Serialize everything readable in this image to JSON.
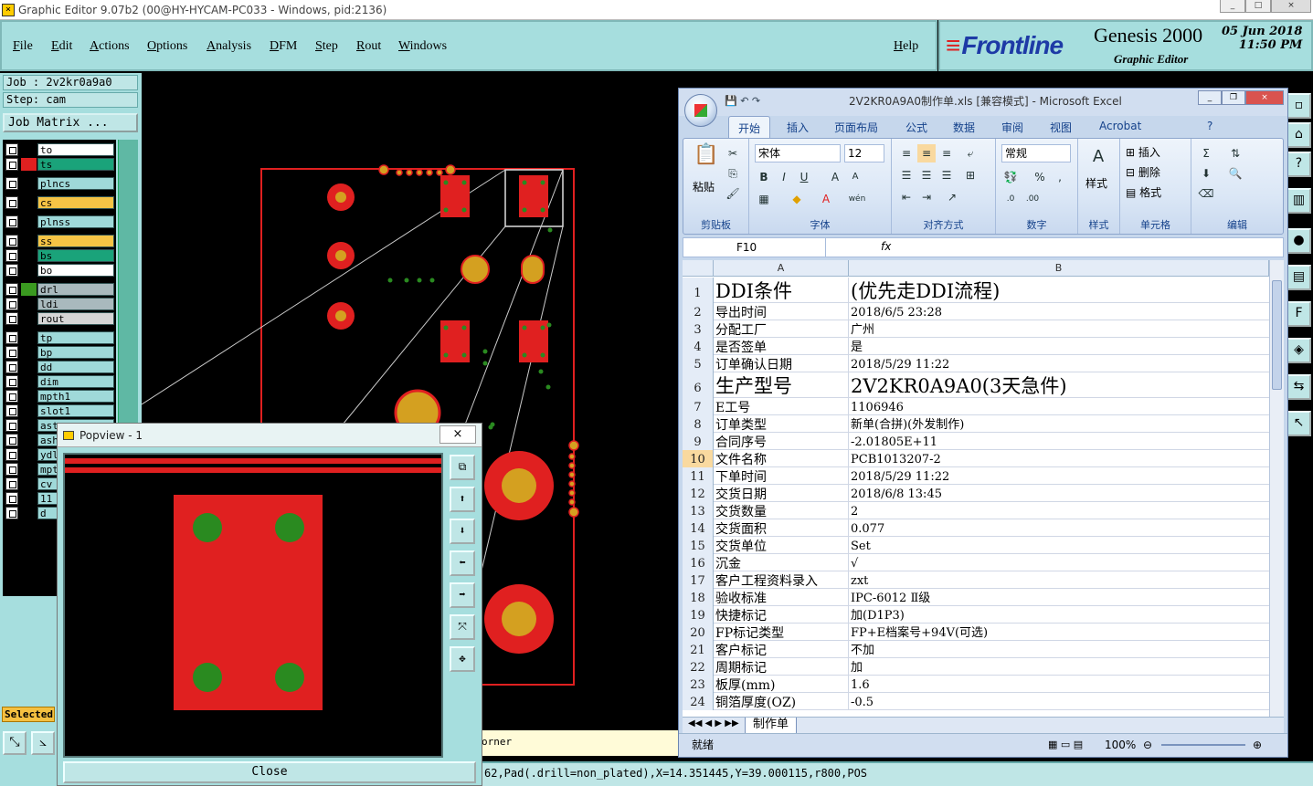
{
  "window": {
    "title": "Graphic Editor 9.07b2 (00@HY-HYCAM-PC033 - Windows, pid:2136)"
  },
  "menu": {
    "items": [
      "File",
      "Edit",
      "Actions",
      "Options",
      "Analysis",
      "DFM",
      "Step",
      "Rout",
      "Windows"
    ],
    "help": "Help"
  },
  "brand": {
    "logo": "Frontline",
    "product": "Genesis 2000",
    "subtitle": "Graphic Editor",
    "date": "05 Jun 2018",
    "time": "11:50 PM"
  },
  "job": {
    "job_label": "Job : 2v2kr0a9a0",
    "step_label": "Step: cam",
    "matrix_button": "Job Matrix ..."
  },
  "layers": [
    {
      "name": "to",
      "bg": "#ffffff",
      "swatch": "#000000"
    },
    {
      "name": "ts",
      "bg": "#1aa37a",
      "swatch": "#e02020",
      "active": true
    },
    {
      "name": "plncs",
      "bg": "#9fd9d9",
      "swatch": "#000000"
    },
    {
      "name": "cs",
      "bg": "#f6c445",
      "swatch": "#000000"
    },
    {
      "name": "plnss",
      "bg": "#9fd9d9",
      "swatch": "#000000"
    },
    {
      "name": "ss",
      "bg": "#f6c445",
      "swatch": "#000000"
    },
    {
      "name": "bs",
      "bg": "#1aa37a",
      "swatch": "#000000"
    },
    {
      "name": "bo",
      "bg": "#ffffff",
      "swatch": "#000000"
    },
    {
      "name": "drl",
      "bg": "#a9b9bd",
      "swatch": "#3a9a20"
    },
    {
      "name": "ldi",
      "bg": "#a9b9bd",
      "swatch": "#000000"
    },
    {
      "name": "rout",
      "bg": "#d6d6d6",
      "swatch": "#000000"
    },
    {
      "name": "tp",
      "bg": "#9fd9d9",
      "swatch": "#000000"
    },
    {
      "name": "bp",
      "bg": "#9fd9d9",
      "swatch": "#000000"
    },
    {
      "name": "dd",
      "bg": "#9fd9d9",
      "swatch": "#000000"
    },
    {
      "name": "dim",
      "bg": "#9fd9d9",
      "swatch": "#000000"
    },
    {
      "name": "mpth1",
      "bg": "#9fd9d9",
      "swatch": "#000000"
    },
    {
      "name": "slot1",
      "bg": "#9fd9d9",
      "swatch": "#000000"
    },
    {
      "name": "ast",
      "bg": "#9fd9d9",
      "swatch": "#000000"
    },
    {
      "name": "ash",
      "bg": "#9fd9d9",
      "swatch": "#000000"
    },
    {
      "name": "ydl",
      "bg": "#9fd9d9",
      "swatch": "#000000"
    },
    {
      "name": "mpt",
      "bg": "#9fd9d9",
      "swatch": "#000000"
    },
    {
      "name": "cv",
      "bg": "#9fd9d9",
      "swatch": "#000000"
    },
    {
      "name": "11",
      "bg": "#9fd9d9",
      "swatch": "#000000"
    },
    {
      "name": "d",
      "bg": "#9fd9d9",
      "swatch": "#000000"
    }
  ],
  "selected_label": "Selected",
  "popview": {
    "title": "Popview - 1",
    "close_x": "×",
    "close_button": "Close"
  },
  "hint": "orner",
  "status_line": "62,Pad(.drill=non_plated),X=14.351445,Y=39.000115,r800,POS",
  "excel": {
    "title": "2V2KR0A9A0制作单.xls  [兼容模式] - Microsoft Excel",
    "tabs": [
      "开始",
      "插入",
      "页面布局",
      "公式",
      "数据",
      "审阅",
      "视图",
      "Acrobat"
    ],
    "groups": [
      "剪贴板",
      "字体",
      "对齐方式",
      "数字",
      "样式",
      "单元格",
      "编辑"
    ],
    "paste": "粘贴",
    "font_name": "宋体",
    "font_size": "12",
    "number_format": "常规",
    "style_label": "样式",
    "cell_insert": "插入",
    "cell_delete": "删除",
    "cell_format": "格式",
    "name_box": "F10",
    "fx": "fx",
    "columns": [
      "A",
      "B"
    ],
    "rows": [
      {
        "n": "1",
        "a": "DDI条件",
        "b": "(优先走DDI流程)",
        "big": true
      },
      {
        "n": "2",
        "a": "导出时间",
        "b": "2018/6/5 23:28"
      },
      {
        "n": "3",
        "a": "分配工厂",
        "b": "广州"
      },
      {
        "n": "4",
        "a": "是否签单",
        "b": "是"
      },
      {
        "n": "5",
        "a": "订单确认日期",
        "b": "2018/5/29 11:22"
      },
      {
        "n": "6",
        "a": "生产型号",
        "b": "2V2KR0A9A0(3天急件)",
        "big": true
      },
      {
        "n": "7",
        "a": "E工号",
        "b": "1106946"
      },
      {
        "n": "8",
        "a": "订单类型",
        "b": "新单(合拼)(外发制作)"
      },
      {
        "n": "9",
        "a": "合同序号",
        "b": "-2.01805E+11"
      },
      {
        "n": "10",
        "a": "文件名称",
        "b": "PCB1013207-2",
        "sel": true
      },
      {
        "n": "11",
        "a": "下单时间",
        "b": "2018/5/29 11:22"
      },
      {
        "n": "12",
        "a": "交货日期",
        "b": "2018/6/8 13:45"
      },
      {
        "n": "13",
        "a": "交货数量",
        "b": "2"
      },
      {
        "n": "14",
        "a": "交货面积",
        "b": "0.077"
      },
      {
        "n": "15",
        "a": "交货单位",
        "b": "Set"
      },
      {
        "n": "16",
        "a": "沉金",
        "b": "√"
      },
      {
        "n": "17",
        "a": "客户工程资料录入",
        "b": "zxt"
      },
      {
        "n": "18",
        "a": "验收标准",
        "b": "IPC-6012 Ⅱ级"
      },
      {
        "n": "19",
        "a": "快捷标记",
        "b": "加(D1P3)"
      },
      {
        "n": "20",
        "a": "FP标记类型",
        "b": "FP+E档案号+94V(可选)"
      },
      {
        "n": "21",
        "a": "客户标记",
        "b": "不加"
      },
      {
        "n": "22",
        "a": "周期标记",
        "b": "加"
      },
      {
        "n": "23",
        "a": "板厚(mm)",
        "b": "1.6"
      },
      {
        "n": "24",
        "a": "铜箔厚度(OZ)",
        "b": "-0.5"
      }
    ],
    "sheet_tab": "制作单",
    "status_ready": "就绪",
    "zoom": "100%"
  }
}
